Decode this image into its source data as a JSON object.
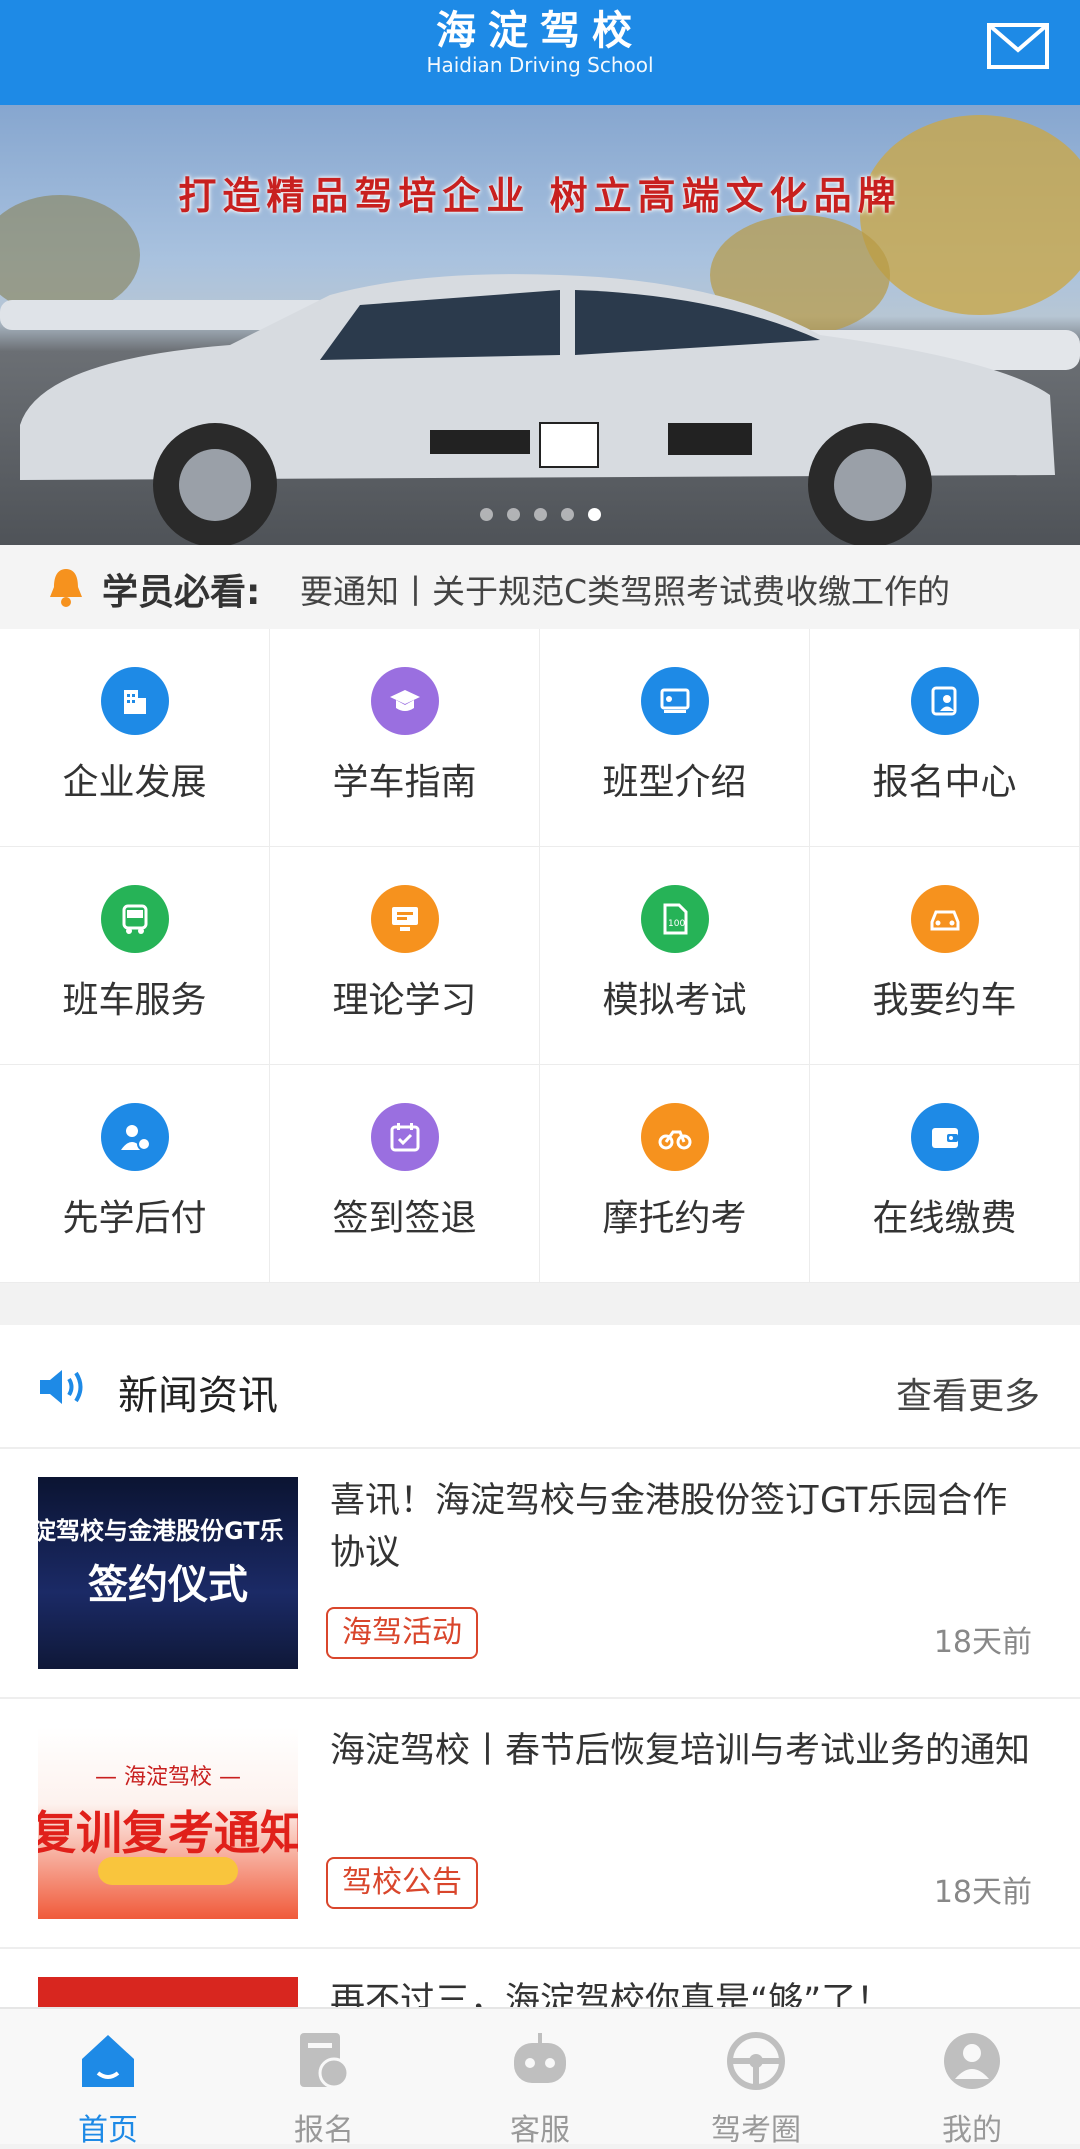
{
  "header": {
    "logo_cn": "海淀驾校",
    "logo_en": "Haidian Driving School",
    "mail_icon": "mail-icon"
  },
  "banner": {
    "slogan": "打造精品驾培企业  树立高端文化品牌",
    "slides": 5,
    "active_slide": 5
  },
  "notice": {
    "label": "学员必看:",
    "text": "要通知丨关于规范C类驾照考试费收缴工作的"
  },
  "grid": [
    {
      "label": "企业发展",
      "icon": "building-icon",
      "color": "#1e8ae6"
    },
    {
      "label": "学车指南",
      "icon": "graduation-icon",
      "color": "#9a6fe0"
    },
    {
      "label": "班型介绍",
      "icon": "classroom-icon",
      "color": "#1e8ae6"
    },
    {
      "label": "报名中心",
      "icon": "signup-icon",
      "color": "#1e8ae6"
    },
    {
      "label": "班车服务",
      "icon": "bus-icon",
      "color": "#26b357"
    },
    {
      "label": "理论学习",
      "icon": "monitor-icon",
      "color": "#f6921e"
    },
    {
      "label": "模拟考试",
      "icon": "exam-icon",
      "color": "#26b357"
    },
    {
      "label": "我要约车",
      "icon": "car-icon",
      "color": "#f6921e"
    },
    {
      "label": "先学后付",
      "icon": "payuser-icon",
      "color": "#1e8ae6"
    },
    {
      "label": "签到签退",
      "icon": "calendar-icon",
      "color": "#9a6fe0"
    },
    {
      "label": "摩托约考",
      "icon": "motorcycle-icon",
      "color": "#f6921e"
    },
    {
      "label": "在线缴费",
      "icon": "wallet-icon",
      "color": "#1e8ae6"
    }
  ],
  "news": {
    "title": "新闻资讯",
    "more": "查看更多",
    "items": [
      {
        "title": "喜讯！海淀驾校与金港股份签订GT乐园合作协议",
        "tag": "海驾活动",
        "age": "18天前",
        "thumb_line1": "海淀驾校与金港股份GT乐",
        "thumb_line2": "签约仪式"
      },
      {
        "title": "海淀驾校丨春节后恢复培训与考试业务的通知",
        "tag": "驾校公告",
        "age": "18天前",
        "thumb_line1": "— 海淀驾校 —",
        "thumb_line2": "复训复考通知"
      },
      {
        "title": "再不过三，海淀驾校你真是“够”了！"
      }
    ]
  },
  "tabbar": [
    {
      "label": "首页",
      "icon": "home-icon",
      "active": true
    },
    {
      "label": "报名",
      "icon": "signup-icon",
      "active": false
    },
    {
      "label": "客服",
      "icon": "robot-icon",
      "active": false
    },
    {
      "label": "驾考圈",
      "icon": "steering-wheel-icon",
      "active": false
    },
    {
      "label": "我的",
      "icon": "profile-icon",
      "active": false
    }
  ]
}
